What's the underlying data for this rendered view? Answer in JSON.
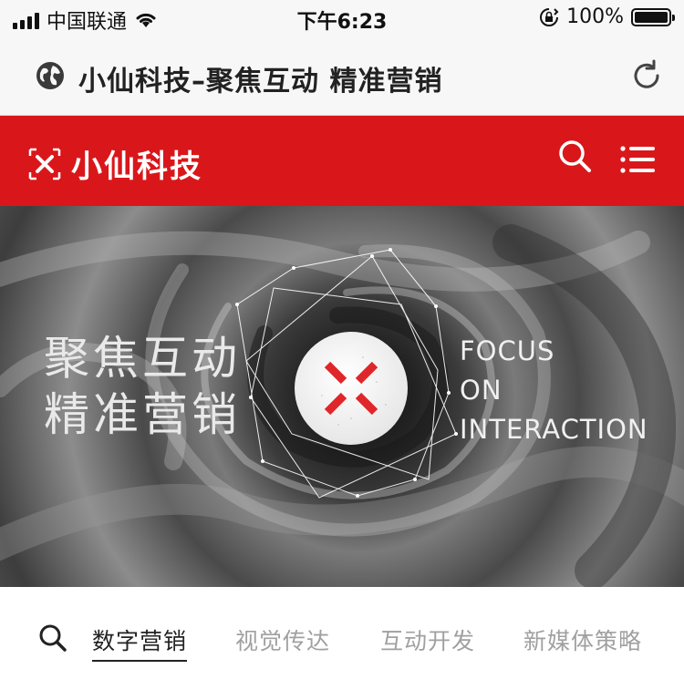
{
  "status_bar": {
    "carrier": "中国联通",
    "time": "下午6:23",
    "battery_percent": "100%",
    "signal_icon": "signal-bars-icon",
    "wifi_icon": "wifi-icon",
    "lock_icon": "rotation-lock-icon"
  },
  "browser": {
    "page_title": "小仙科技–聚焦互动 精准营销",
    "globe_icon": "globe-icon",
    "reload_icon": "reload-icon"
  },
  "header": {
    "brand_name": "小仙科技",
    "background": "#d9171b",
    "search_icon": "search-icon",
    "menu_icon": "menu-icon"
  },
  "hero": {
    "cn_line1": "聚焦互动",
    "cn_line2": "精准营销",
    "en_line1": "FOCUS",
    "en_line2": "ON",
    "en_line3": "INTERACTION",
    "badge_icon": "x-logo-icon",
    "accent": "#e0262a"
  },
  "category_tabs": {
    "search_icon": "search-icon",
    "items": [
      {
        "label": "数字营销",
        "active": true
      },
      {
        "label": "视觉传达",
        "active": false
      },
      {
        "label": "互动开发",
        "active": false
      },
      {
        "label": "新媒体策略",
        "active": false
      }
    ]
  }
}
